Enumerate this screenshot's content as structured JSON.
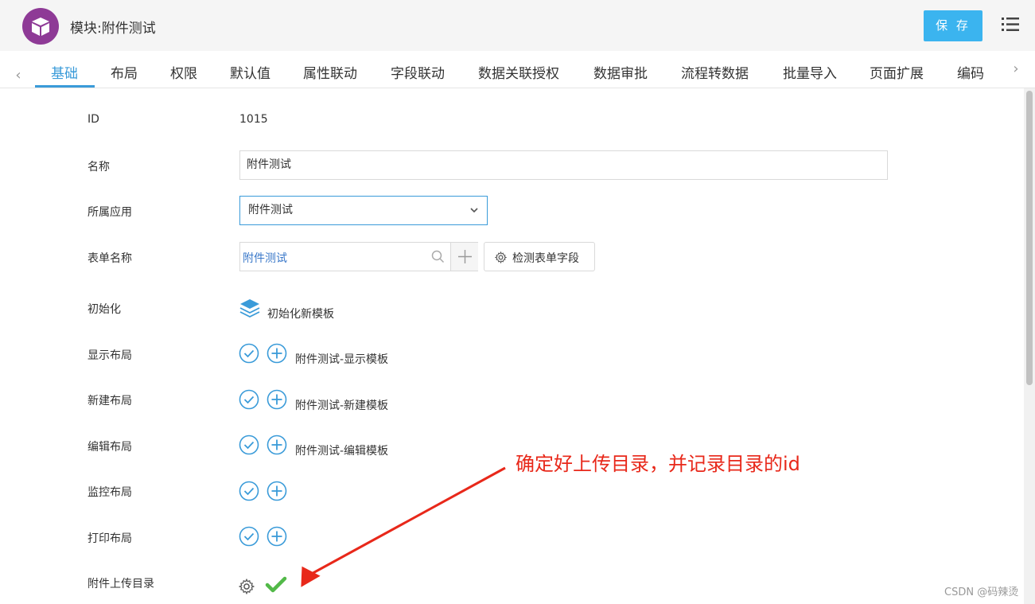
{
  "header": {
    "title": "模块:附件测试",
    "save_label": "保 存"
  },
  "tabs": [
    {
      "label": "基础",
      "active": true
    },
    {
      "label": "布局"
    },
    {
      "label": "权限"
    },
    {
      "label": "默认值"
    },
    {
      "label": "属性联动"
    },
    {
      "label": "字段联动"
    },
    {
      "label": "数据关联授权"
    },
    {
      "label": "数据审批"
    },
    {
      "label": "流程转数据"
    },
    {
      "label": "批量导入"
    },
    {
      "label": "页面扩展"
    },
    {
      "label": "编码"
    }
  ],
  "form": {
    "id_label": "ID",
    "id_value": "1015",
    "name_label": "名称",
    "name_value": "附件测试",
    "app_label": "所属应用",
    "app_value": "附件测试",
    "form_label": "表单名称",
    "form_value": "附件测试",
    "detect_label": "检测表单字段",
    "init_label": "初始化",
    "init_action": "初始化新模板",
    "display_label": "显示布局",
    "display_value": "附件测试-显示模板",
    "new_label": "新建布局",
    "new_value": "附件测试-新建模板",
    "edit_label": "编辑布局",
    "edit_value": "附件测试-编辑模板",
    "monitor_label": "监控布局",
    "print_label": "打印布局",
    "upload_label": "附件上传目录"
  },
  "annotation": "确定好上传目录，并记录目录的id",
  "watermark": "CSDN @码辣烫",
  "colors": {
    "accent": "#3a9bd9",
    "save": "#3bb4ef",
    "logo": "#8e3a96",
    "annotation": "#e8281a",
    "check": "#52b948"
  }
}
